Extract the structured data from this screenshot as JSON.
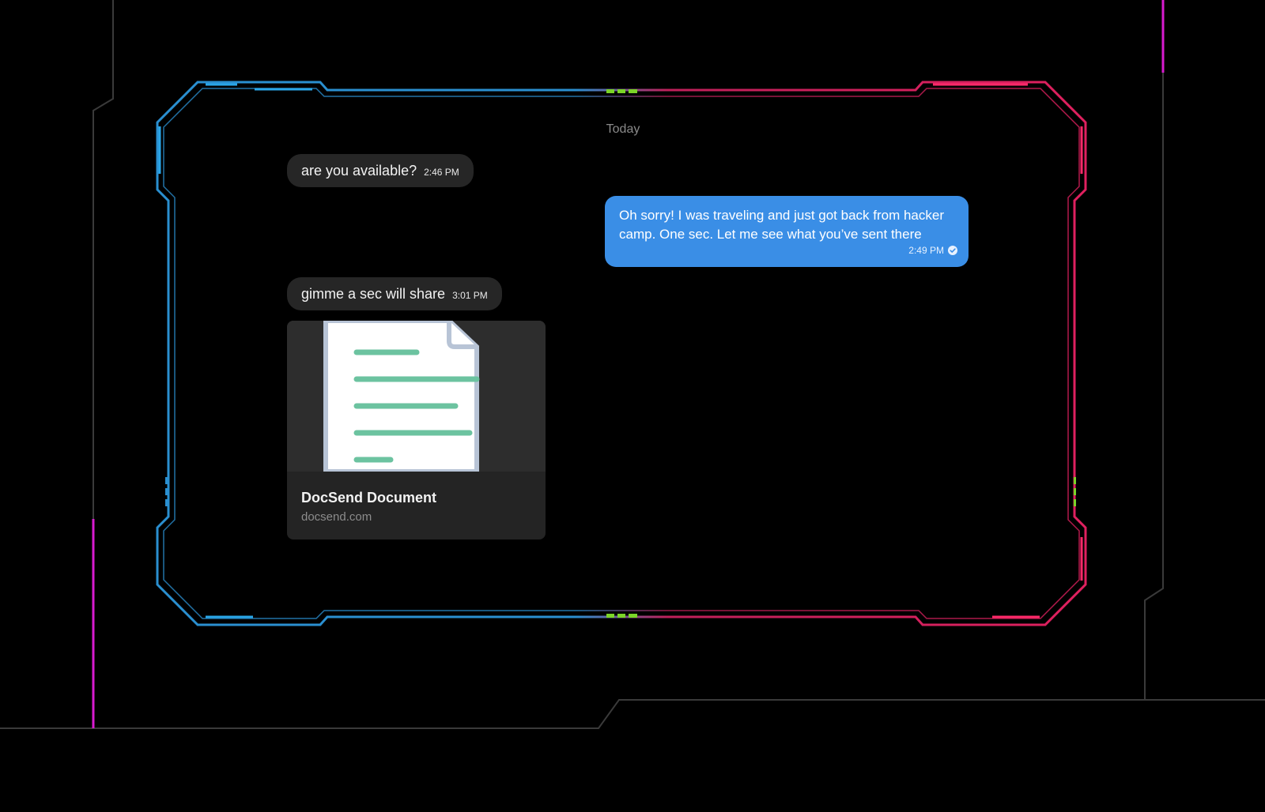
{
  "conversation": {
    "day_label": "Today",
    "messages": [
      {
        "direction": "incoming",
        "text": "are you available?",
        "time": "2:46 PM"
      },
      {
        "direction": "outgoing",
        "text": "Oh sorry!  I was traveling and just got back from hacker camp.  One sec.  Let me see what you’ve sent there",
        "time": "2:49 PM",
        "status_icon": "read-check-icon"
      },
      {
        "direction": "incoming",
        "text": "gimme a sec will share",
        "time": "3:01 PM"
      }
    ],
    "link_preview": {
      "title": "DocSend Document",
      "domain": "docsend.com",
      "thumbnail_icon": "document-icon"
    }
  },
  "colors": {
    "background": "#000000",
    "frame_left": "#2a8fd0",
    "frame_right": "#e0205f",
    "frame_accent": "#7bd428",
    "accent_magenta": "#d81bd0",
    "outgoing_bubble": "#3a8ee6",
    "incoming_bubble": "#262626",
    "doc_line": "#6cc3a0"
  }
}
